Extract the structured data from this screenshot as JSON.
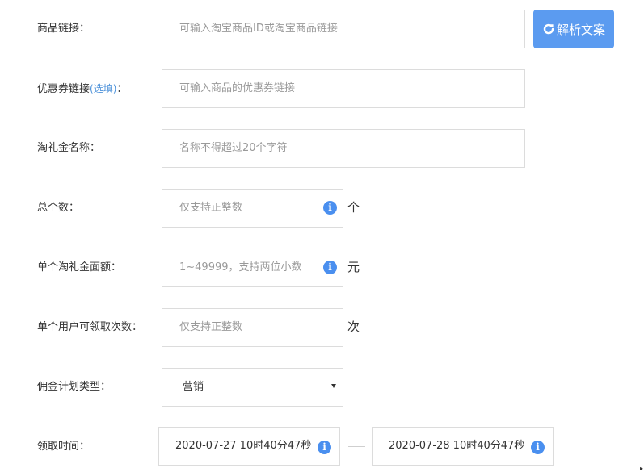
{
  "product_link": {
    "label": "商品链接：",
    "placeholder": "可输入淘宝商品ID或淘宝商品链接",
    "parse_button": "解析文案"
  },
  "coupon_link": {
    "label": "优惠券链接",
    "optional": "(选填)",
    "colon": "：",
    "placeholder": "可输入商品的优惠券链接"
  },
  "gift_name": {
    "label": "淘礼金名称：",
    "placeholder": "名称不得超过20个字符"
  },
  "total_count": {
    "label": "总个数：",
    "placeholder": "仅支持正整数",
    "unit": "个",
    "info_icon": "i"
  },
  "amount": {
    "label": "单个淘礼金面额：",
    "placeholder": "1~49999，支持两位小数",
    "unit": "元",
    "info_icon": "i"
  },
  "per_user": {
    "label": "单个用户可领取次数：",
    "placeholder": "仅支持正整数",
    "unit": "次"
  },
  "commission_plan": {
    "label": "佣金计划类型：",
    "selected": "营销"
  },
  "claim_time": {
    "label": "领取时间：",
    "start": "2020-07-27 10时40分47秒",
    "end": "2020-07-28 10时40分47秒",
    "info_icon": "i"
  },
  "colors": {
    "accent": "#5b9bf0",
    "info_icon": "#4a8fef",
    "optional_text": "#4a90d9",
    "border": "#dcdcdc",
    "placeholder": "#9a9a9a"
  }
}
